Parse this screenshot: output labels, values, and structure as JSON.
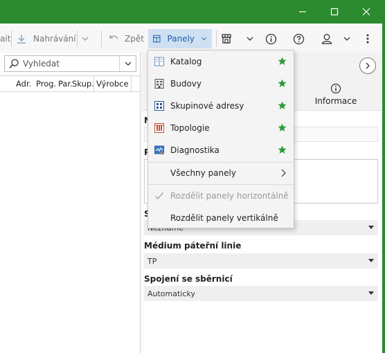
{
  "colors": {
    "accent_green": "#2b8a2e",
    "panely_bg": "#cfe0f3",
    "star_green": "#2e9a3a"
  },
  "window": {
    "minimize_icon": "minimize-icon",
    "maximize_icon": "maximize-icon",
    "close_icon": "close-icon"
  },
  "toolbar": {
    "cut_label": "ait",
    "upload_label": "Nahrávání",
    "undo_label": "Zpět",
    "panels_label": "Panely",
    "icons": [
      "download-icon",
      "undo-icon",
      "panels-icon",
      "shop-icon",
      "info-icon",
      "help-icon",
      "user-icon",
      "more-icon"
    ]
  },
  "search": {
    "placeholder": "Vyhledat"
  },
  "left_table": {
    "columns": [
      "Adr.",
      "Prog.",
      "Par.",
      "Skup.",
      "Výrobce"
    ]
  },
  "right_panel": {
    "info_tab": "Informace",
    "label_n": "N",
    "label_p": "P",
    "label_s": "S",
    "s_value": "Neznámé",
    "medium_label": "Médium páteřní linie",
    "medium_value": "TP",
    "bus_label": "Spojení se sběrnicí",
    "bus_value": "Automaticky"
  },
  "menu": {
    "items": [
      {
        "label": "Katalog",
        "icon": "catalog-icon",
        "pinned": true
      },
      {
        "label": "Budovy",
        "icon": "buildings-icon",
        "pinned": true
      },
      {
        "label": "Skupinové adresy",
        "icon": "group-addresses-icon",
        "pinned": true
      },
      {
        "label": "Topologie",
        "icon": "topology-icon",
        "pinned": true
      },
      {
        "label": "Diagnostika",
        "icon": "diagnostics-icon",
        "pinned": true
      }
    ],
    "all_panels": "Všechny panely",
    "split_horizontal": "Rozdělit panely horizontálně",
    "split_vertical": "Rozdělit panely vertikálně"
  }
}
